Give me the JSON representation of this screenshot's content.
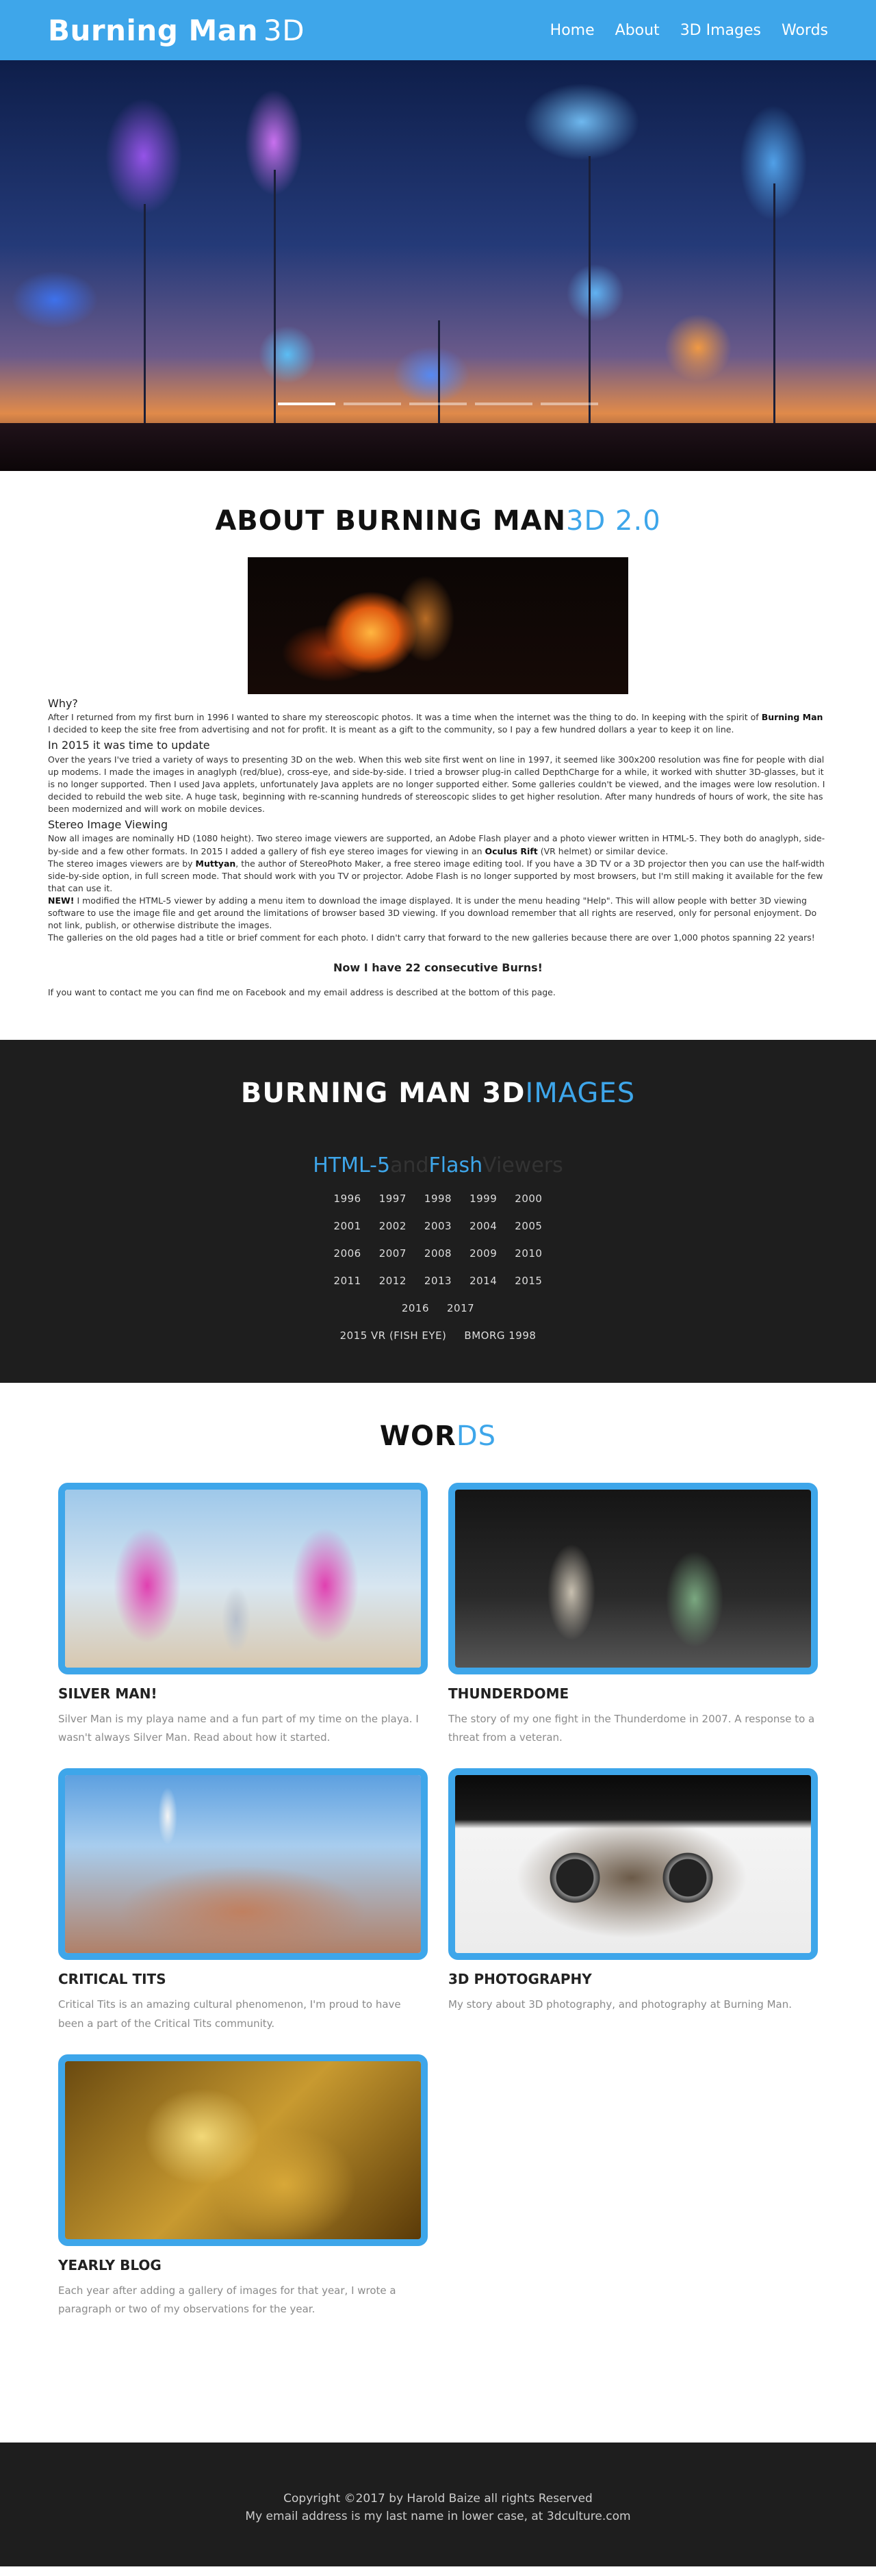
{
  "header": {
    "brand_bold": "Burning Man",
    "brand_thin": "3D",
    "nav": [
      "Home",
      "About",
      "3D Images",
      "Words"
    ]
  },
  "about": {
    "title": "ABOUT BURNING MAN",
    "title_accent": "3D 2.0",
    "sections": [
      {
        "heading": "Why?",
        "text_a": "After I returned from my first burn in 1996 I wanted to share my stereoscopic photos. It was a time when the internet was the thing to do. In keeping with the spirit of ",
        "bold": "Burning Man",
        "text_b": " I decided to keep the site free from advertising and not for profit. It is meant as a gift to the community, so I pay a few hundred dollars a year to keep it on line."
      },
      {
        "heading": "In 2015 it was time to update",
        "text": "Over the years I've tried a variety of ways to presenting 3D on the web. When this web site first went on line in 1997, it seemed like 300x200 resolution was fine for people with dial up modems. I made the images in anaglyph (red/blue), cross-eye, and side-by-side. I tried a browser plug-in called DepthCharge for a while, it worked with shutter 3D-glasses, but it is no longer supported. Then I used Java applets, unfortunately Java applets are no longer supported either. Some galleries couldn't be viewed, and the images were low resolution. I decided to rebuild the web site. A huge task, beginning with re-scanning hundreds of stereoscopic slides to get higher resolution. After many hundreds of hours of work, the site has been modernized and will work on mobile devices."
      },
      {
        "heading": "Stereo Image Viewing",
        "p1_a": "Now all images are nominally HD (1080 height). Two stereo image viewers are supported, an Adobe Flash player and a photo viewer written in HTML-5. They both do anaglyph, side-by-side and a few other formats. In 2015 I added a gallery of fish eye stereo images for viewing in an ",
        "p1_bold": "Oculus Rift",
        "p1_b": " (VR helmet) or similar device.",
        "p2_a": "The stereo images viewers are by ",
        "p2_bold": "Muttyan",
        "p2_b": ", the author of StereoPhoto Maker, a free stereo image editing tool. If you have a 3D TV or a 3D projector then you can use the half-width side-by-side option, in full screen mode. That should work with you TV or projector. Adobe Flash is no longer supported by most browsers, but I'm still making it available for the few that can use it.",
        "p3_bold": "NEW!",
        "p3_b": " I modified the HTML-5 viewer by adding a menu item to download the image displayed. It is under the menu heading \"Help\". This will allow people with better 3D viewing software to use the image file and get around the limitations of browser based 3D viewing. If you download remember that all rights are reserved, only for personal enjoyment. Do not link, publish, or otherwise distribute the images.",
        "p4": "The galleries on the old pages had a title or brief comment for each photo. I didn't carry that forward to the new galleries because there are over 1,000 photos spanning 22 years!"
      }
    ],
    "highlight": "Now I have 22 consecutive Burns!",
    "contact": "If you want to contact me you can find me on Facebook and my email address is described at the bottom of this page."
  },
  "images": {
    "title": "BURNING MAN 3D",
    "title_accent": "IMAGES",
    "viewers": {
      "html5": "HTML-5",
      "and": "and",
      "flash": "Flash",
      "viewers": "Viewers"
    },
    "year_rows": [
      [
        "1996",
        "1997",
        "1998",
        "1999",
        "2000"
      ],
      [
        "2001",
        "2002",
        "2003",
        "2004",
        "2005"
      ],
      [
        "2006",
        "2007",
        "2008",
        "2009",
        "2010"
      ],
      [
        "2011",
        "2012",
        "2013",
        "2014",
        "2015"
      ],
      [
        "2016",
        "2017"
      ],
      [
        "2015 VR (FISH EYE)",
        "BMORG 1998"
      ]
    ]
  },
  "words": {
    "title": "WOR",
    "title_accent": "DS",
    "cards": [
      {
        "title": "SILVER MAN!",
        "desc": "Silver Man is my playa name and a fun part of my time on the playa. I wasn't always Silver Man. Read about how it started."
      },
      {
        "title": "THUNDERDOME",
        "desc": "The story of my one fight in the Thunderdome in 2007. A response to a threat from a veteran."
      },
      {
        "title": "CRITICAL TITS",
        "desc": "Critical Tits is an amazing cultural phenomenon, I'm proud to have been a part of the Critical Tits community."
      },
      {
        "title": "3D PHOTOGRAPHY",
        "desc": "My story about 3D photography, and photography at Burning Man."
      },
      {
        "title": "YEARLY BLOG",
        "desc": "Each year after adding a gallery of images for that year, I wrote a paragraph or two of my observations for the year."
      }
    ]
  },
  "footer": {
    "line1": "Copyright ©2017 by Harold Baize all rights Reserved",
    "line2": "My email address is my last name in lower case, at 3dculture.com"
  },
  "colors": {
    "accent": "#3ea6ea",
    "dark": "#1e1e1e"
  }
}
